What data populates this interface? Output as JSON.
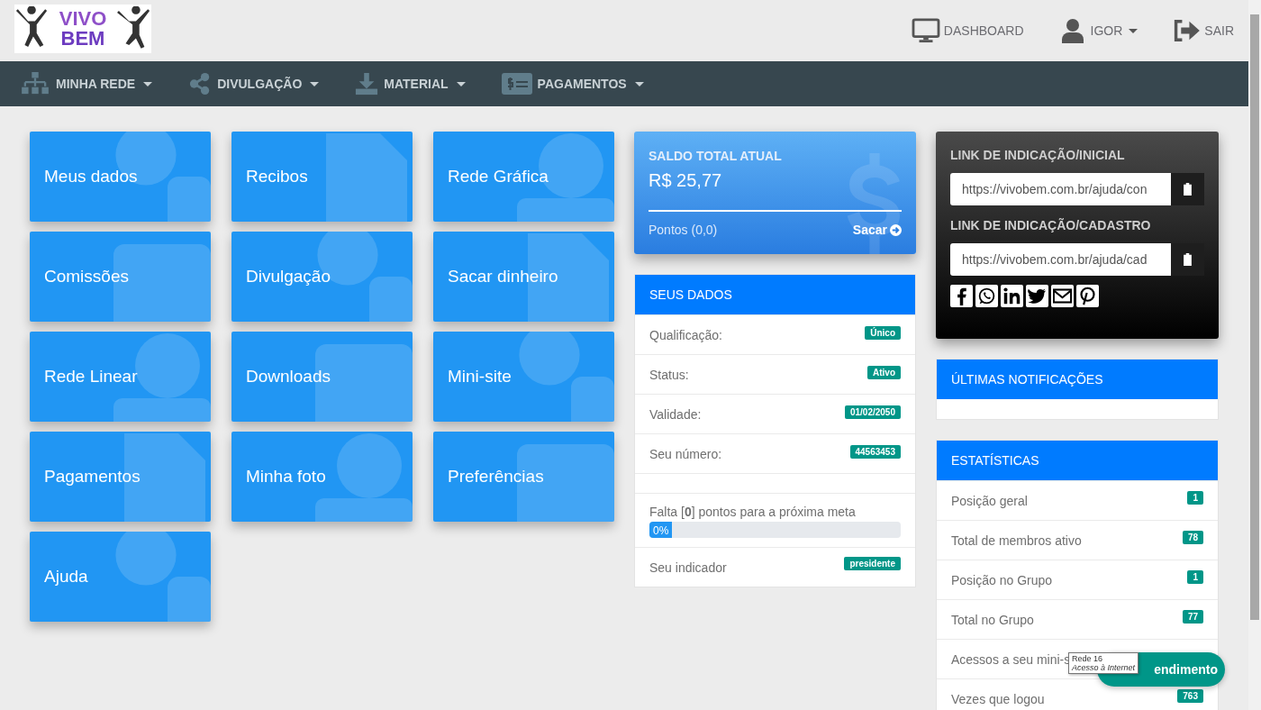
{
  "header": {
    "logo": {
      "line_1": "VIVO",
      "line_2": "BEM"
    },
    "links": [
      {
        "kind": "monitor",
        "label": "DASHBOARD",
        "dropdown": false
      },
      {
        "kind": "user",
        "label": "IGOR",
        "dropdown": true
      },
      {
        "kind": "exit",
        "label": "SAIR",
        "dropdown": false
      }
    ]
  },
  "nav": [
    {
      "kind": "tree",
      "label": "MINHA REDE"
    },
    {
      "kind": "share",
      "label": "DIVULGAÇÃO"
    },
    {
      "kind": "download",
      "label": "MATERIAL"
    },
    {
      "kind": "money",
      "label": "PAGAMENTOS"
    }
  ],
  "tiles": [
    {
      "label": "Meus dados"
    },
    {
      "label": "Recibos"
    },
    {
      "label": "Rede Gráfica"
    },
    {
      "label": "Comissões"
    },
    {
      "label": "Divulgação"
    },
    {
      "label": "Sacar dinheiro"
    },
    {
      "label": "Rede Linear"
    },
    {
      "label": "Downloads"
    },
    {
      "label": "Mini-site"
    },
    {
      "label": "Pagamentos"
    },
    {
      "label": "Minha foto"
    },
    {
      "label": "Preferências"
    },
    {
      "label": "Ajuda"
    }
  ],
  "balance": {
    "title": "SALDO TOTAL ATUAL",
    "amount": "R$ 25,77",
    "points": "Pontos (0,0)",
    "withdraw": "Sacar"
  },
  "seus_dados": {
    "title": "SEUS DADOS",
    "rows": [
      {
        "label": "Qualificação:",
        "value": "Único"
      },
      {
        "label": "Status:",
        "value": "Ativo"
      },
      {
        "label": "Validade:",
        "value": "01/02/2050"
      },
      {
        "label": "Seu número:",
        "value": "44563453"
      }
    ],
    "goal": {
      "text": "Falta [**0**] pontos para a próxima meta",
      "level": 0,
      "reading": "0%"
    },
    "indicator": {
      "label": "Seu indicador",
      "value": "presidente"
    }
  },
  "links": {
    "items": [
      {
        "title": "LINK DE INDICAÇÃO/INICIAL",
        "value": "https://vivobem.com.br/ajuda/con"
      },
      {
        "title": "LINK DE INDICAÇÃO/CADASTRO",
        "value": "https://vivobem.com.br/ajuda/cad"
      }
    ],
    "share": [
      {
        "kind": "facebook"
      },
      {
        "kind": "whatsapp"
      },
      {
        "kind": "linkedin"
      },
      {
        "kind": "twitter"
      },
      {
        "kind": "email"
      },
      {
        "kind": "pinterest"
      }
    ]
  },
  "notifications": {
    "title": "ÚLTIMAS NOTIFICAÇÕES"
  },
  "stats": {
    "title": "ESTATÍSTICAS",
    "rows": [
      {
        "label": "Posição geral",
        "value": "1"
      },
      {
        "label": "Total de membros ativo",
        "value": "78"
      },
      {
        "label": "Posição no Grupo",
        "value": "1"
      },
      {
        "label": "Total no Grupo",
        "value": "77"
      },
      {
        "label": "Acessos a seu mini-s"
      },
      {
        "label": "Vezes que logou",
        "value": "763"
      }
    ]
  },
  "chat_button": "endimento",
  "tooltip": {
    "title": "Rede 16",
    "subtitle": "Acesso à Internet"
  }
}
